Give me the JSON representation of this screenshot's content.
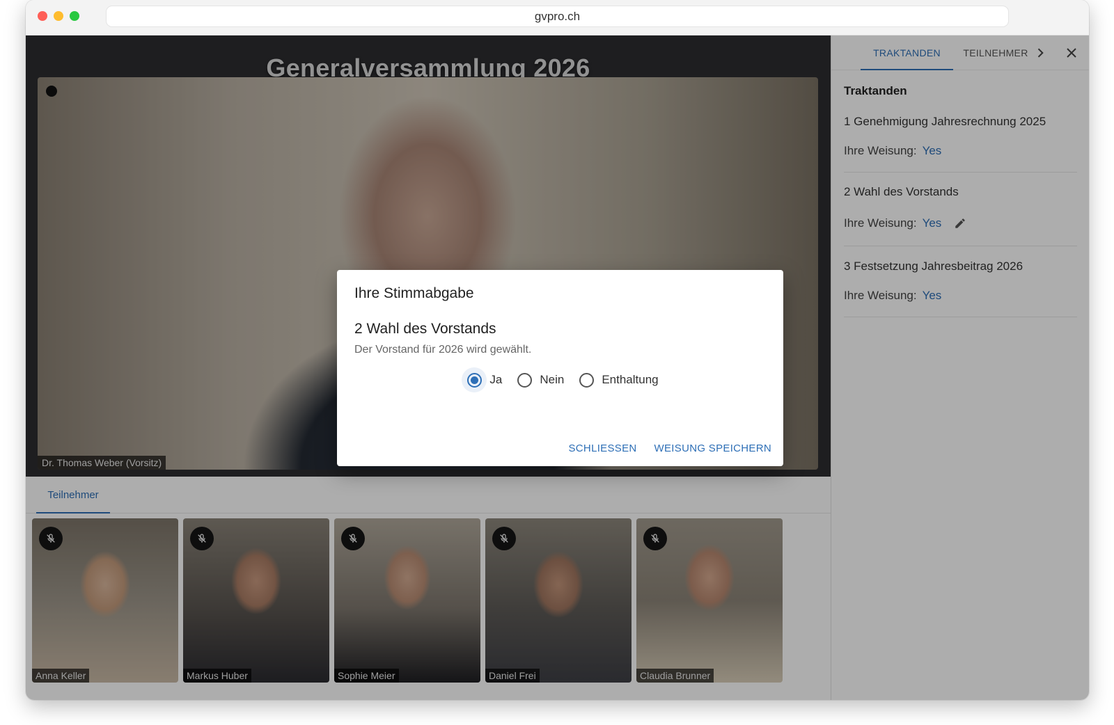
{
  "browser": {
    "url": "gvpro.ch"
  },
  "stage": {
    "title": "Generalversammlung 2026",
    "speaker_name": "Dr. Thomas Weber (Vorsitz)"
  },
  "participants_tab": {
    "label": "Teilnehmer"
  },
  "participants": [
    {
      "name": "Anna Keller"
    },
    {
      "name": "Markus Huber"
    },
    {
      "name": "Sophie Meier"
    },
    {
      "name": "Daniel Frei"
    },
    {
      "name": "Claudia Brunner"
    }
  ],
  "sidebar": {
    "tabs": [
      {
        "label": "TRAKTANDEN"
      },
      {
        "label": "TEILNEHMER"
      }
    ],
    "heading": "Traktanden",
    "weisung_label": "Ihre Weisung:",
    "items": [
      {
        "title": "1 Genehmigung Jahresrechnung 2025",
        "value": "Yes"
      },
      {
        "title": "2 Wahl des Vorstands",
        "value": "Yes"
      },
      {
        "title": "3 Festsetzung Jahresbeitrag 2026",
        "value": "Yes"
      }
    ]
  },
  "dialog": {
    "title": "Ihre Stimmabgabe",
    "item_title": "2 Wahl des Vorstands",
    "description": "Der Vorstand für 2026 wird gewählt.",
    "options": [
      {
        "label": "Ja"
      },
      {
        "label": "Nein"
      },
      {
        "label": "Enthaltung"
      }
    ],
    "selected": "Ja",
    "close_label": "SCHLIESSEN",
    "save_label": "WEISUNG SPEICHERN"
  },
  "colors": {
    "accent": "#2e6fb6",
    "overlay": "#000000"
  }
}
